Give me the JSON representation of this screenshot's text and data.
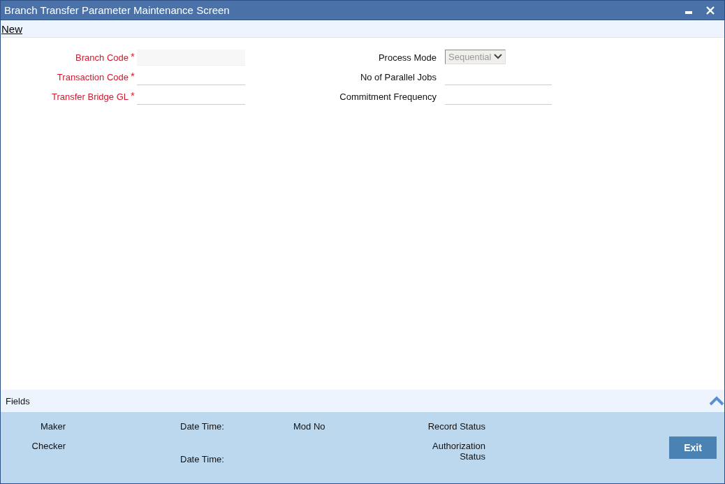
{
  "window": {
    "title": "Branch Transfer Parameter Maintenance Screen"
  },
  "toolbar": {
    "link": "New"
  },
  "form_left": [
    {
      "label": "Branch Code",
      "required_mark": "*",
      "disabled": true
    },
    {
      "label": "Transaction Code",
      "required_mark": "*",
      "disabled": false
    },
    {
      "label": "Transfer Bridge GL",
      "required_mark": "*",
      "disabled": false
    }
  ],
  "form_right": [
    {
      "kind": "select",
      "label": "Process Mode",
      "value": "Sequential",
      "disabled": true
    },
    {
      "kind": "text",
      "label": "No of Parallel Jobs",
      "disabled": false
    },
    {
      "kind": "text",
      "label": "Commitment Frequency",
      "disabled": false
    }
  ],
  "fields_bar": {
    "label": "Fields"
  },
  "audit": {
    "maker": "Maker",
    "checker": "Checker",
    "maker_date_time": "Date Time:",
    "checker_date_time": "Date Time:",
    "mod_no": "Mod No",
    "record_status": "Record Status",
    "authorization_status": "Authorization Status"
  },
  "buttons": [
    "Exit"
  ]
}
